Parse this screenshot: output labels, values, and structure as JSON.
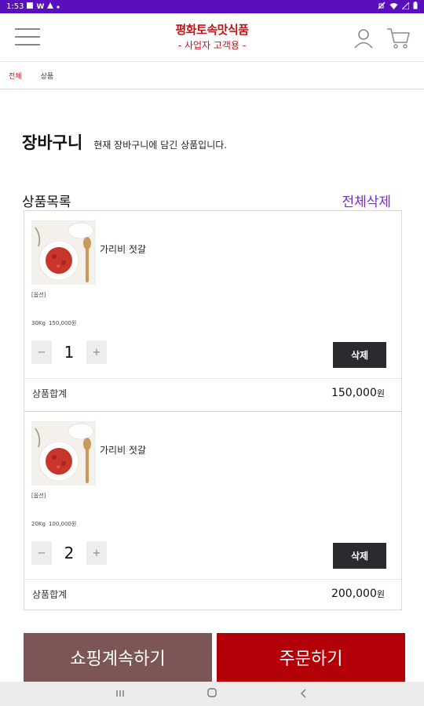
{
  "status_bar": {
    "time": "1:53",
    "icons_left": [
      "notification-icon",
      "w-icon",
      "a-icon",
      "dot-icon"
    ],
    "icons_right": [
      "mute-icon",
      "wifi-icon",
      "no-sim-icon",
      "battery-icon"
    ]
  },
  "header": {
    "brand_name": "평화토속맛식품",
    "brand_sub": "- 사업자 고객용 -",
    "menu_icon": "hamburger-icon",
    "user_icon": "user-icon",
    "cart_icon": "cart-icon",
    "brand_color": "#c0141b"
  },
  "breadcrumb": {
    "home": "전체",
    "current": "상품"
  },
  "page": {
    "title": "장바구니",
    "description": "현재 장바구니에 담긴 상품입니다."
  },
  "cart": {
    "list_title": "상품목록",
    "delete_all": "전체삭제",
    "items": [
      {
        "name": "가리비 젓갈",
        "option_label": "[옵션]",
        "option_weight": "30Kg",
        "option_price": "150,000원",
        "quantity": "1",
        "minus": "−",
        "plus": "+",
        "delete_label": "삭제",
        "subtotal_label": "상품합계",
        "subtotal_value": "150,000",
        "subtotal_unit": "원"
      },
      {
        "name": "가리비 젓갈",
        "option_label": "[옵션]",
        "option_weight": "20Kg",
        "option_price": "100,000원",
        "quantity": "2",
        "minus": "−",
        "plus": "+",
        "delete_label": "삭제",
        "subtotal_label": "상품합계",
        "subtotal_value": "200,000",
        "subtotal_unit": "원"
      }
    ]
  },
  "actions": {
    "continue_shopping": "쇼핑계속하기",
    "order": "주문하기",
    "continue_color": "#7c5656",
    "order_color": "#b30008"
  },
  "nav_bar": {
    "icons": [
      "recents-icon",
      "home-icon",
      "back-icon"
    ]
  }
}
